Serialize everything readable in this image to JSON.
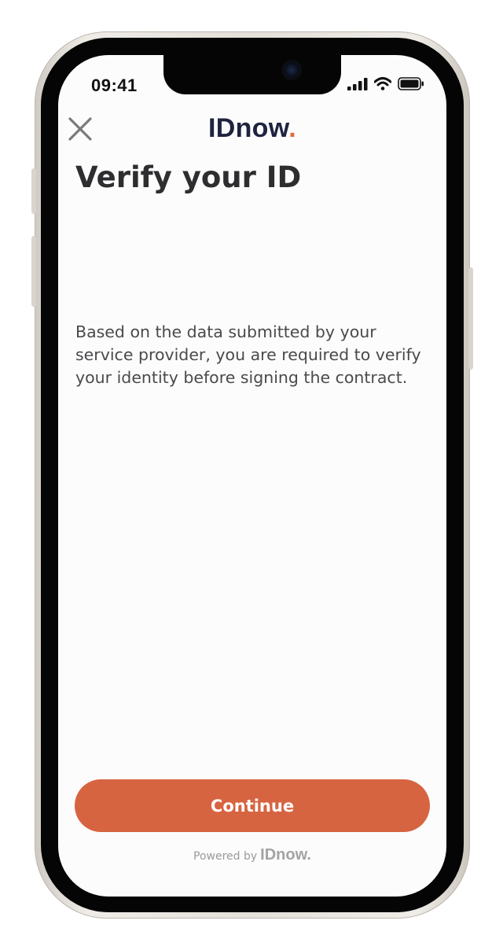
{
  "status_bar": {
    "time": "09:41",
    "icons": [
      "signal-icon",
      "wifi-icon",
      "battery-icon"
    ]
  },
  "header": {
    "close_icon": "close-icon",
    "brand": "IDnow",
    "brand_dot": "."
  },
  "main": {
    "title": "Verify your ID",
    "description": "Based on the data submitted by your service provider, you are required to verify your identity before signing the contract."
  },
  "actions": {
    "continue_label": "Continue"
  },
  "footer": {
    "powered_by": "Powered by",
    "logo": "IDnow",
    "logo_dot": "."
  },
  "colors": {
    "accent": "#d76441",
    "brand_navy": "#1e2340",
    "brand_dot": "#e0693f",
    "background": "#fcfcfc"
  }
}
